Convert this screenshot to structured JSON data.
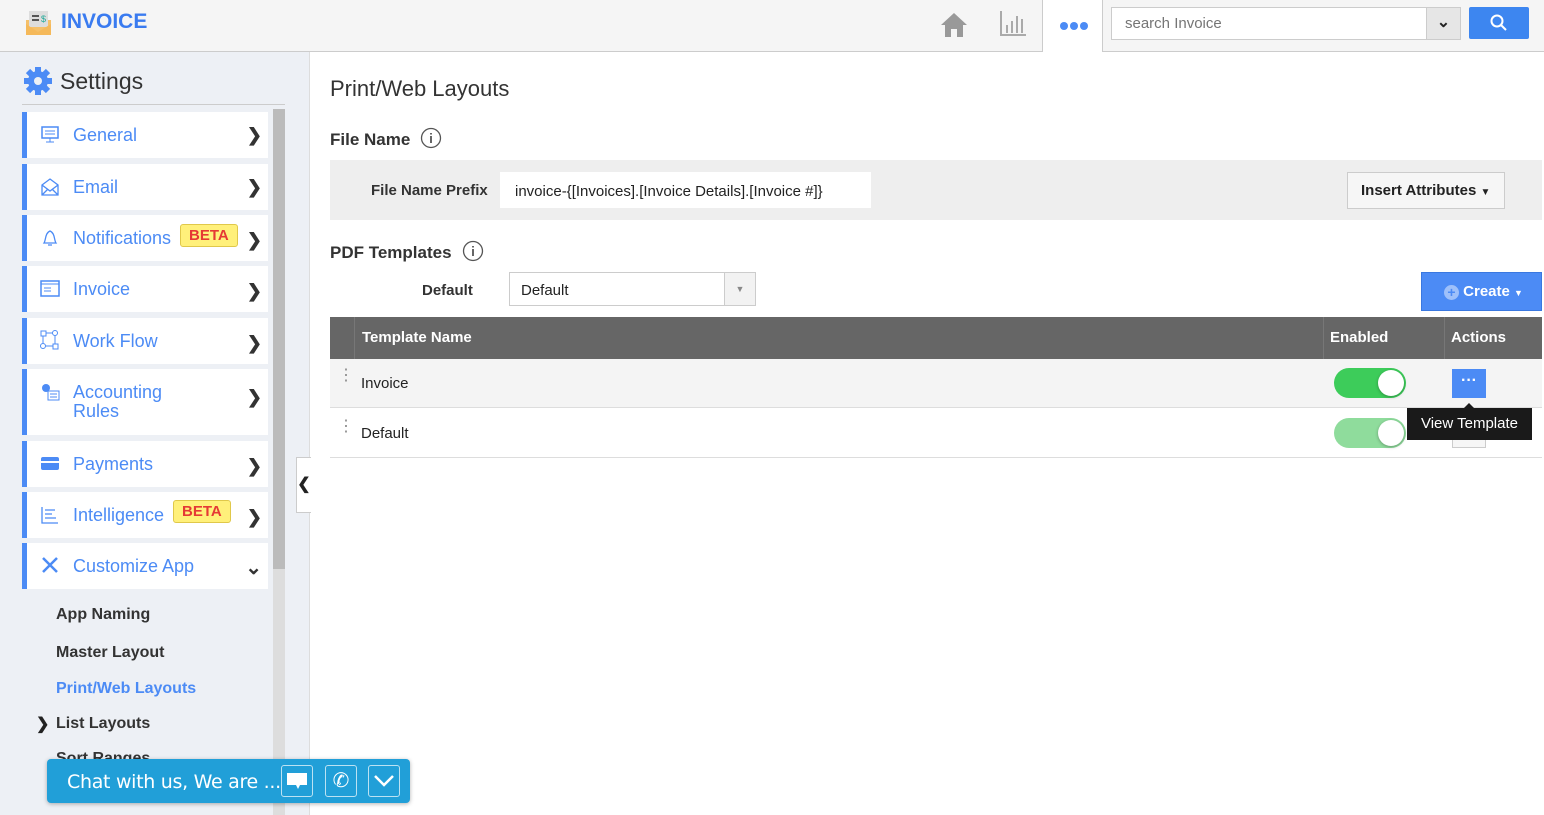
{
  "app": {
    "title": "INVOICE",
    "logo_icon": "invoice-envelope-icon"
  },
  "topbar": {
    "home_icon": "home-icon",
    "chart_icon": "bar-chart-icon",
    "more_icon": "more-dots-icon",
    "search_placeholder": "search Invoice",
    "search_icon": "search-icon"
  },
  "sidebar": {
    "title": "Settings",
    "items": [
      {
        "label": "General",
        "icon": "monitor-icon"
      },
      {
        "label": "Email",
        "icon": "envelope-icon"
      },
      {
        "label": "Notifications",
        "icon": "bell-icon",
        "badge": "BETA"
      },
      {
        "label": "Invoice",
        "icon": "window-icon"
      },
      {
        "label": "Work Flow",
        "icon": "workflow-icon"
      },
      {
        "label": "Accounting Rules",
        "icon": "gear-doc-icon"
      },
      {
        "label": "Payments",
        "icon": "credit-card-icon"
      },
      {
        "label": "Intelligence",
        "icon": "list-icon",
        "badge": "BETA"
      },
      {
        "label": "Customize App",
        "icon": "tools-icon"
      }
    ],
    "subitems": [
      "App Naming",
      "Master Layout",
      "Print/Web Layouts",
      "List Layouts",
      "Sort Ranges"
    ]
  },
  "main": {
    "title": "Print/Web Layouts",
    "file_name": {
      "heading": "File Name",
      "prefix_label": "File Name Prefix",
      "prefix_value": "invoice-{[Invoices].[Invoice Details].[Invoice #]}",
      "insert_button": "Insert Attributes"
    },
    "pdf": {
      "heading": "PDF Templates",
      "default_label": "Default",
      "default_value": "Default",
      "create_button": "Create"
    },
    "table": {
      "columns": [
        "Template Name",
        "Enabled",
        "Actions"
      ],
      "rows": [
        {
          "name": "Invoice",
          "enabled": true
        },
        {
          "name": "Default",
          "enabled": true
        }
      ]
    },
    "tooltip": "View Template"
  },
  "chat": {
    "text": "Chat with us, We are ..."
  },
  "colors": {
    "accent": "#4c8bf5",
    "header": "#666666",
    "toggle_on": "#3dcc5a",
    "chat": "#219fd8",
    "beta_bg": "#fff07a"
  }
}
